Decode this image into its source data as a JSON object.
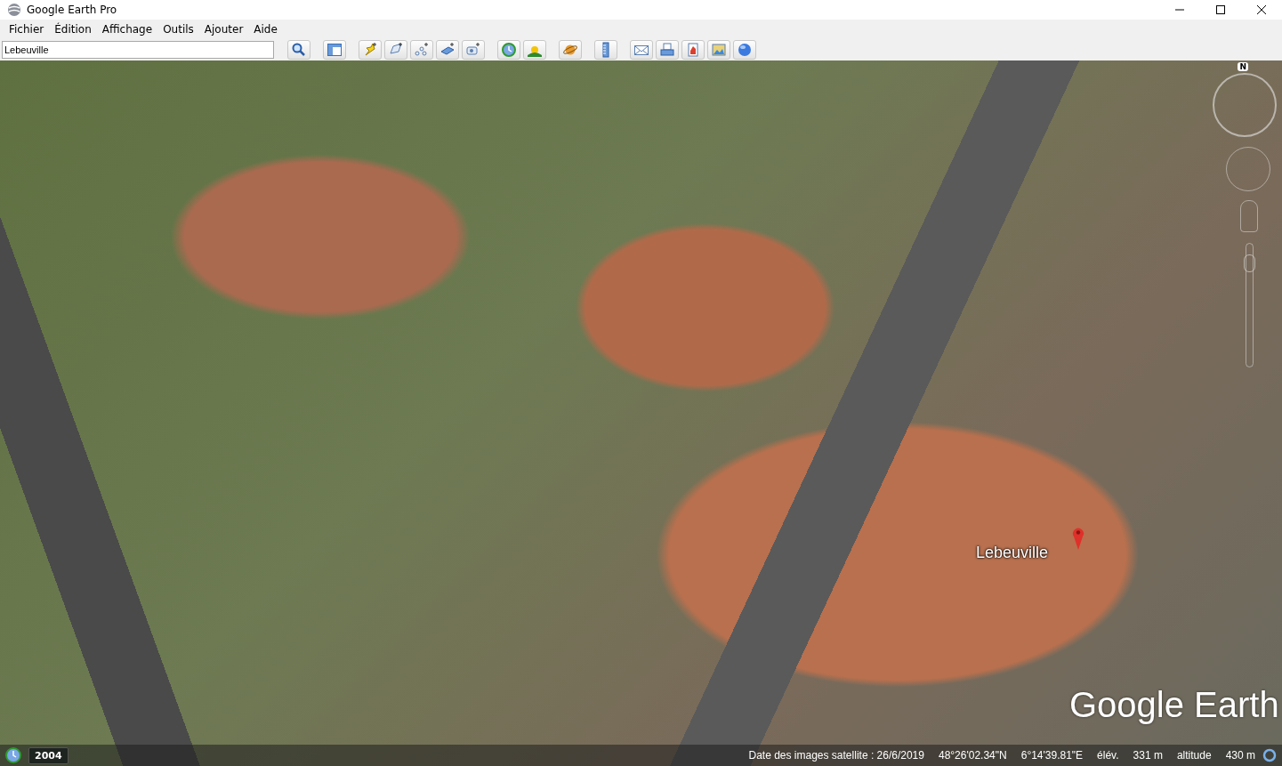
{
  "window": {
    "title": "Google Earth Pro"
  },
  "menu": [
    {
      "label": "Fichier"
    },
    {
      "label": "Édition"
    },
    {
      "label": "Affichage"
    },
    {
      "label": "Outils"
    },
    {
      "label": "Ajouter"
    },
    {
      "label": "Aide"
    }
  ],
  "search": {
    "value": "Lebeuville"
  },
  "map": {
    "placemark": {
      "label": "Lebeuville"
    },
    "logo": "Google Earth",
    "compass": {
      "north": "N"
    },
    "zoom_slider": {
      "level": 0.9
    },
    "timeline": {
      "year": "2004"
    }
  },
  "status_bar": {
    "imagery_date": "Date des images satellite : 26/6/2019",
    "latitude": "48°26'02.34\"N",
    "longitude": "6°14'39.81\"E",
    "elevation_label": "élév.",
    "elevation": "331 m",
    "altitude_label": "altitude",
    "altitude": "430 m"
  }
}
